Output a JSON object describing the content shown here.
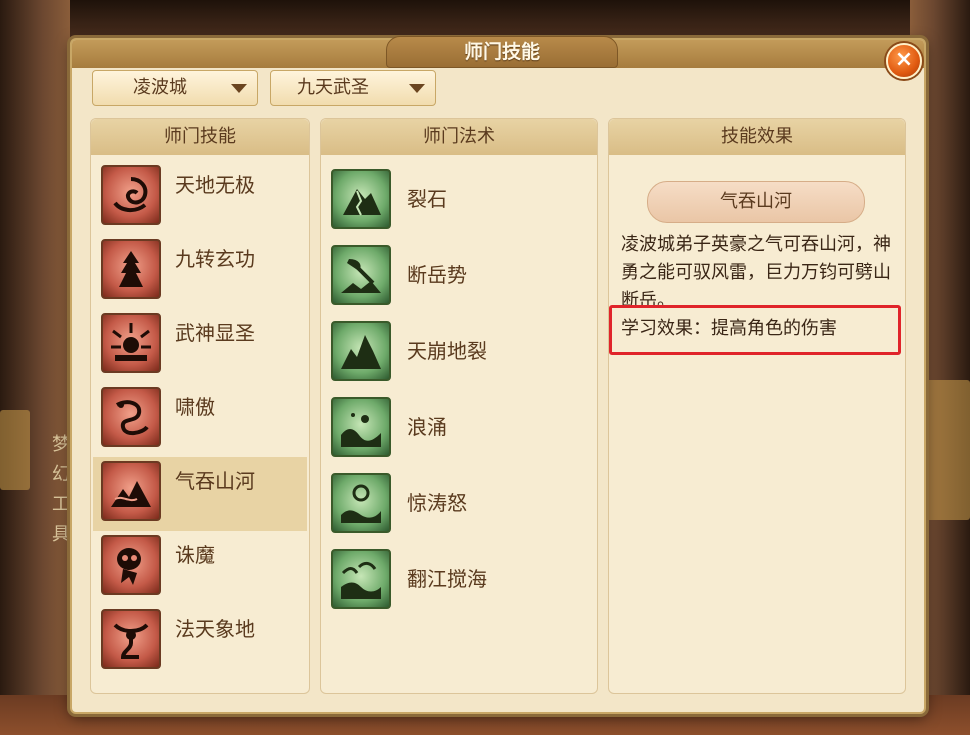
{
  "dialog": {
    "title": "师门技能",
    "close_label": "×"
  },
  "filters": {
    "school": "凌波城",
    "rank": "九天武圣"
  },
  "skills_panel": {
    "header": "师门技能",
    "items": [
      {
        "label": "天地无极",
        "icon": "whirlwind-icon"
      },
      {
        "label": "九转玄功",
        "icon": "tower-icon"
      },
      {
        "label": "武神显圣",
        "icon": "radiant-sun-icon"
      },
      {
        "label": "啸傲",
        "icon": "dragon-icon"
      },
      {
        "label": "气吞山河",
        "icon": "mountain-icon",
        "selected": true
      },
      {
        "label": "诛魔",
        "icon": "skull-icon"
      },
      {
        "label": "法天象地",
        "icon": "warrior-icon"
      }
    ]
  },
  "spells_panel": {
    "header": "师门法术",
    "items": [
      {
        "label": "裂石",
        "icon": "cracked-rock-icon"
      },
      {
        "label": "断岳势",
        "icon": "axe-icon"
      },
      {
        "label": "天崩地裂",
        "icon": "peaks-icon"
      },
      {
        "label": "浪涌",
        "icon": "wave-icon"
      },
      {
        "label": "惊涛怒",
        "icon": "storm-wave-icon"
      },
      {
        "label": "翻江搅海",
        "icon": "sea-icon"
      }
    ]
  },
  "effect_panel": {
    "header": "技能效果",
    "skill_name": "气吞山河",
    "description": "凌波城弟子英豪之气可吞山河，神勇之能可驭风雷，巨力万钧可劈山断岳。",
    "learn_effect": "学习效果：提高角色的伤害"
  },
  "background": {
    "side_text": "梦幻工具"
  },
  "colors": {
    "highlight": "#e0242a",
    "accent": "#c8a766"
  }
}
